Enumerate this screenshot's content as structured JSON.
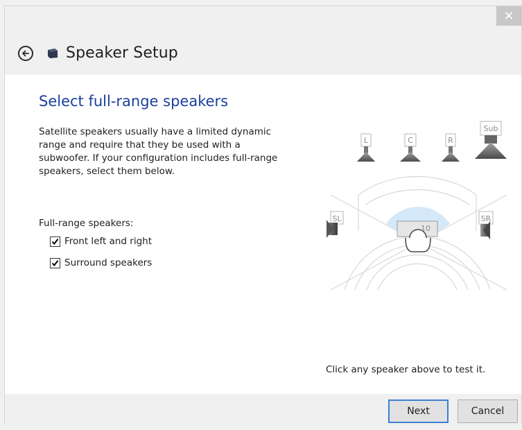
{
  "window": {
    "title": "Speaker Setup",
    "close_glyph": "✕"
  },
  "icons": {
    "back": "back-arrow-icon",
    "app": "speaker-app-icon",
    "close": "close-icon"
  },
  "main": {
    "heading": "Select full-range speakers",
    "description": "Satellite speakers usually have a limited dynamic range and require that they be used with a subwoofer. If your configuration includes full-range speakers, select them below.",
    "group_label": "Full-range speakers:",
    "checkboxes": [
      {
        "label": "Front left and right",
        "checked": true
      },
      {
        "label": "Surround speakers",
        "checked": true
      }
    ],
    "hint": "Click any speaker above to test it."
  },
  "speakers": {
    "left": "L",
    "center": "C",
    "right": "R",
    "sub": "Sub",
    "surround_left": "SL",
    "surround_right": "SR"
  },
  "footer": {
    "next_label": "Next",
    "cancel_label": "Cancel"
  },
  "colors": {
    "heading": "#1a3fa0",
    "focus_border": "#3c7fd1",
    "listener_zone": "#cfe6f7"
  }
}
